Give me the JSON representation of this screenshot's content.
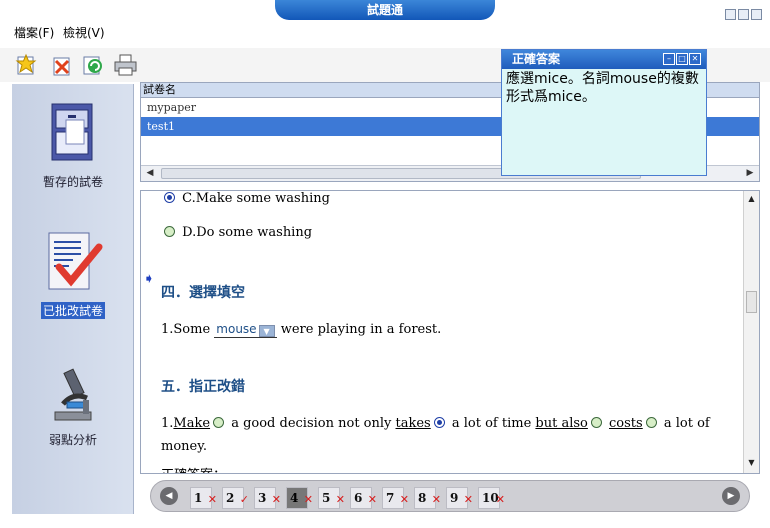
{
  "window": {
    "title": "試題通"
  },
  "menu": {
    "file": "檔案(F)",
    "view": "檢視(V)"
  },
  "toolbar": {
    "tools": [
      "new-paper-icon",
      "delete-icon",
      "refresh-icon",
      "print-icon"
    ]
  },
  "sidebar": {
    "items": [
      {
        "label": "暫存的試卷",
        "icon": "cabinet-icon",
        "selected": false
      },
      {
        "label": "已批改試卷",
        "icon": "graded-paper-icon",
        "selected": true
      },
      {
        "label": "弱點分析",
        "icon": "microscope-icon",
        "selected": false
      }
    ]
  },
  "paper_list": {
    "header": "試卷名",
    "rows": [
      "mypaper",
      "test1"
    ],
    "selected": "test1"
  },
  "content": {
    "option_c": "C.Make some washing",
    "option_d": "D.Do some washing",
    "section4": "四．選擇填空",
    "q1_prefix": "1.Some",
    "q1_dropdown": "mouse",
    "q1_suffix": "were playing in a forest.",
    "section5": "五．指正改錯",
    "q2_number": "1.",
    "q2_w1": "Make",
    "q2_t1": "a good decision not only",
    "q2_w2": "takes",
    "q2_t2": "a lot of time",
    "q2_w3": "but also",
    "q2_w4": "costs",
    "q2_t3": "a lot of",
    "q2_t4": "money.",
    "partial": "正確答案："
  },
  "question_nav": {
    "numbers": [
      "1",
      "2",
      "3",
      "4",
      "5",
      "6",
      "7",
      "8",
      "9",
      "10"
    ],
    "current": "4",
    "marks": [
      "wrong",
      "correct",
      "wrong",
      "wrong",
      "wrong",
      "wrong",
      "wrong",
      "wrong",
      "wrong",
      "wrong"
    ]
  },
  "answer_popup": {
    "title": "正確答案",
    "text": "應選mice。名詞mouse的複數形式爲mice。"
  },
  "colors": {
    "accent": "#2f62c6",
    "title_blue": "#1257b8",
    "section": "#1e4f87",
    "wrong_mark": "#d81c1c"
  }
}
